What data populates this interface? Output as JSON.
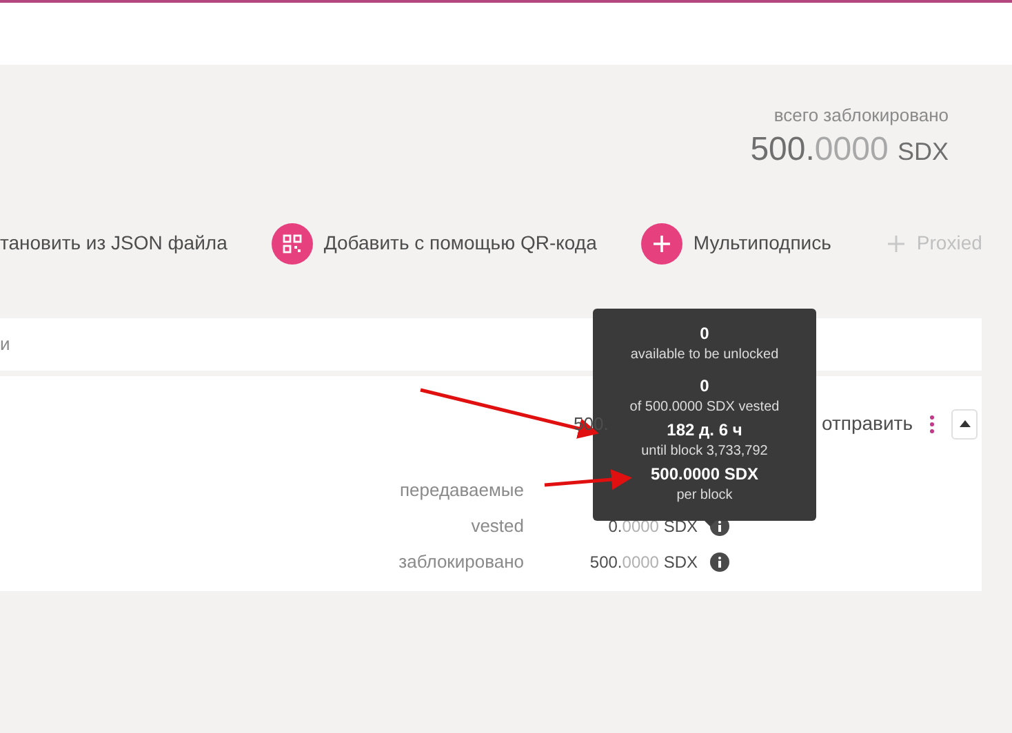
{
  "summary": {
    "label": "всего заблокировано",
    "value_int": "500.",
    "value_frac": "0000",
    "unit": "SDX"
  },
  "actions": [
    {
      "kind": "cut",
      "label": "тановить из JSON файла",
      "disabled": false
    },
    {
      "kind": "qr",
      "label": "Добавить с помощью QR-кода",
      "disabled": false
    },
    {
      "kind": "plus",
      "label": "Мультиподпись",
      "disabled": false
    },
    {
      "kind": "plus",
      "label": "Proxied",
      "disabled": true
    }
  ],
  "table": {
    "column_1": "и",
    "row": {
      "balance": "500.",
      "send_label": "отправить",
      "expanded": true,
      "details": [
        {
          "label": "передаваемые"
        },
        {
          "label": "vested",
          "int": "0.",
          "frac": "0000",
          "unit": "SDX",
          "info": true
        },
        {
          "label": "заблокировано",
          "int": "500.",
          "frac": "0000",
          "unit": "SDX",
          "info": true
        }
      ]
    }
  },
  "tooltip": {
    "groups": [
      {
        "value": "0",
        "caption": "available to be unlocked"
      },
      {
        "value": "0",
        "caption": "of 500.0000 SDX vested"
      },
      {
        "value": "182 д. 6 ч",
        "caption": "until block 3,733,792"
      },
      {
        "value": "500.0000 SDX",
        "caption": "per block"
      }
    ]
  }
}
